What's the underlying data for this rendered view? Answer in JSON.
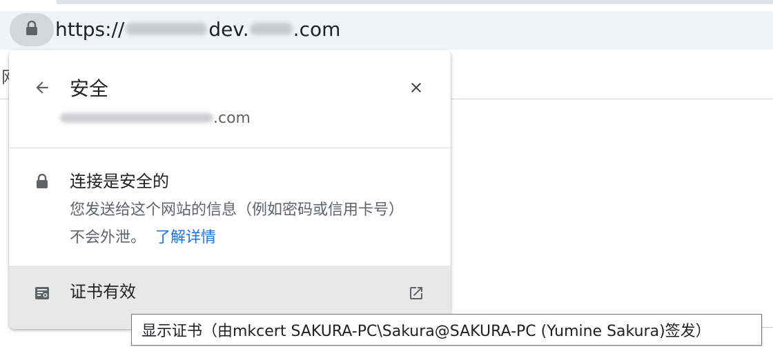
{
  "omnibox": {
    "url_prefix": "https://",
    "url_host_part": "dev.",
    "url_suffix": ".com",
    "lock_icon": "lock-icon"
  },
  "page": {
    "partial_char": "网"
  },
  "popup": {
    "back_icon": "arrow-back-icon",
    "title": "安全",
    "close_icon": "close-icon",
    "site_suffix": ".com",
    "secure_icon": "lock-icon",
    "secure_title": "连接是安全的",
    "secure_desc": "您发送给这个网站的信息（例如密码或信用卡号）不会外泄。",
    "learn_more": "了解详情",
    "cert_icon": "certificate-icon",
    "cert_label": "证书有效",
    "external_icon": "open-in-new-icon"
  },
  "tooltip": {
    "text": "显示证书（由mkcert SAKURA-PC\\Sakura@SAKURA-PC (Yumine Sakura)签发）"
  },
  "colors": {
    "link": "#1a73e8",
    "secondary_text": "#5f6368",
    "omnibox_bg": "#f1f3f4",
    "hover_row": "#e8e8e9"
  }
}
